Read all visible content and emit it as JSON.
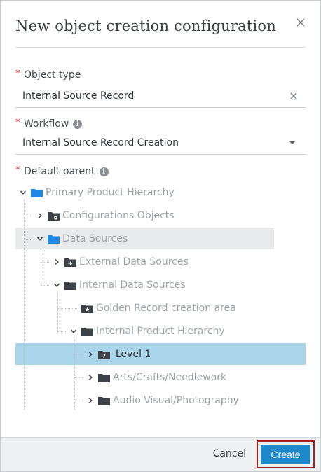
{
  "dialog": {
    "title": "New object creation configuration",
    "close_icon": "close-icon"
  },
  "fields": {
    "object_type": {
      "label": "Object type",
      "value": "Internal Source Record",
      "required": "*"
    },
    "workflow": {
      "label": "Workflow",
      "value": "Internal Source Record Creation",
      "required": "*"
    },
    "default_parent": {
      "label": "Default parent",
      "required": "*"
    }
  },
  "tree": {
    "root": "Primary Product Hierarchy",
    "nodes": [
      {
        "label": "Configurations Objects",
        "icon": "folder-gear-icon"
      },
      {
        "label": "Data Sources",
        "icon": "folder-icon"
      },
      {
        "label": "External Data Sources",
        "icon": "folder-arrow-icon"
      },
      {
        "label": "Internal Data Sources",
        "icon": "folder-icon"
      },
      {
        "label": "Golden Record creation area",
        "icon": "folder-star-icon"
      },
      {
        "label": "Internal Product Hierarchy",
        "icon": "folder-icon"
      },
      {
        "label": "Level 1",
        "icon": "folder-question-icon"
      },
      {
        "label": "Arts/Crafts/Needlework",
        "icon": "folder-icon"
      },
      {
        "label": "Audio Visual/Photography",
        "icon": "folder-icon"
      }
    ]
  },
  "footer": {
    "cancel_label": "Cancel",
    "create_label": "Create"
  },
  "colors": {
    "primary": "#1e88c9",
    "selected_row": "#a9d4ea",
    "hover_row": "#e8eaec",
    "focus_outline": "#9b2226",
    "folder_blue": "#1e88e5",
    "folder_dark": "#3d4248"
  }
}
